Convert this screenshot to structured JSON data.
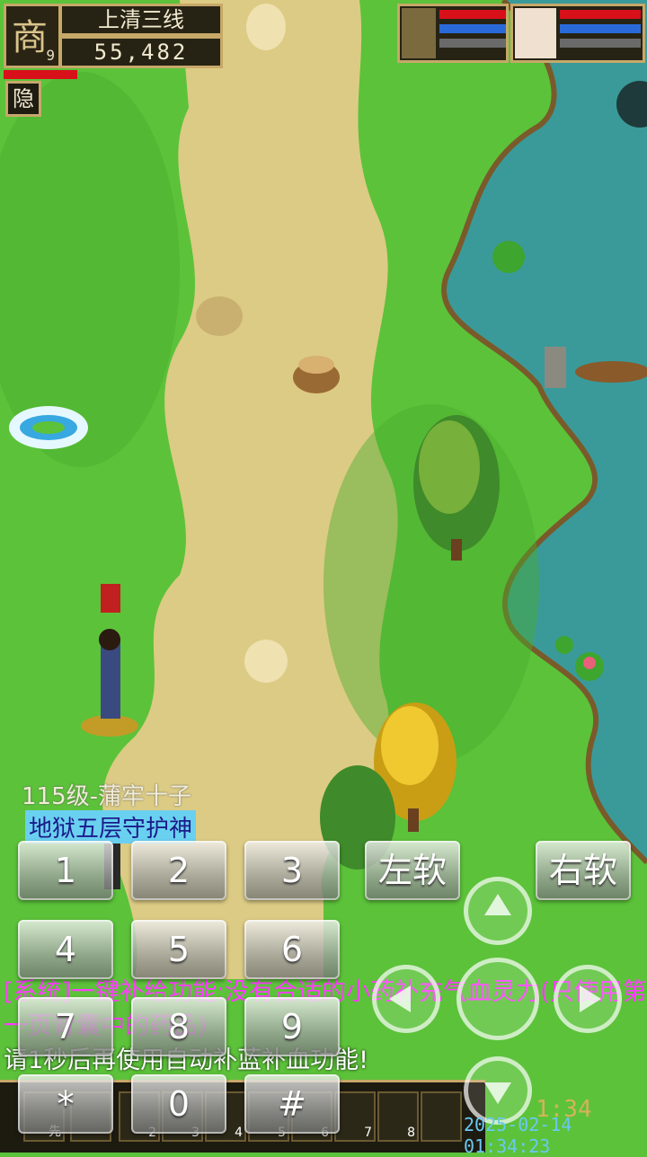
{
  "player": {
    "portrait_glyph": "商",
    "level": "9",
    "server": "上清三线",
    "money": "55,482",
    "hide_label": "隐"
  },
  "npc": {
    "title": "115级-蒲牢十子",
    "subtitle": "地狱五层守护神"
  },
  "keypad": {
    "keys": [
      "1",
      "2",
      "3",
      "4",
      "5",
      "6",
      "7",
      "8",
      "9",
      "*",
      "0",
      "#"
    ],
    "left_soft": "左软",
    "right_soft": "右软"
  },
  "chat": {
    "line1": "[系统]一键补给功能:没有合适的小药补充气血灵力(只使用第一页背囊中的药品)",
    "line2": "请1秒后再使用自动补蓝补血功能!"
  },
  "toolbar": {
    "slots": [
      "先",
      "",
      "2",
      "3",
      "4",
      "5",
      "6",
      "7",
      "8",
      ""
    ]
  },
  "status": {
    "clock": "1:34",
    "timestamp": "2025-02-14 01:34:23"
  },
  "colors": {
    "grass": "#5cc23a",
    "path": "#dccb84",
    "water": "#3a9a9a",
    "hud_gold": "#c6a869",
    "hp_red": "#d8101a",
    "mp_blue": "#2a6ad8",
    "chat_pink": "#ff3cff"
  }
}
